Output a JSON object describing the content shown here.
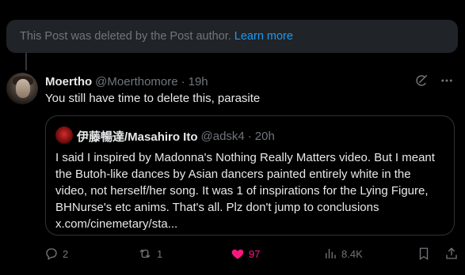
{
  "banner": {
    "text": "This Post was deleted by the Post author.",
    "link": "Learn more"
  },
  "post": {
    "author_name": "Moertho",
    "handle": "@Moerthomore",
    "separator": "·",
    "time": "19h",
    "text": "You still have time to delete this, parasite"
  },
  "quote": {
    "author_name": "伊藤暢達/Masahiro Ito",
    "handle": "@adsk4",
    "separator": "·",
    "time": "20h",
    "lines": [
      "I said I inspired by Madonna's Nothing Really Matters video. But I meant",
      "the Butoh-like dances by Asian dancers painted entirely white in the",
      "video, not herself/her song. It was 1 of inspirations for the Lying Figure,",
      "BHNurse's etc anims. That's all. Plz don't jump to conclusions",
      "x.com/cinemetary/sta..."
    ]
  },
  "actions": {
    "replies": "2",
    "reposts": "1",
    "likes": "97",
    "views": "8.4K"
  },
  "colors": {
    "accent": "#1d9bf0",
    "like": "#f91880",
    "muted": "#71767b"
  }
}
